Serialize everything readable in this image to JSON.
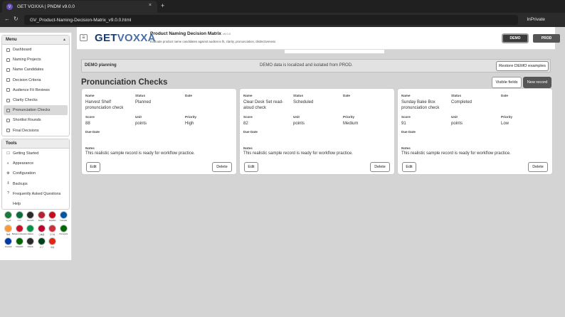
{
  "browser": {
    "tab_title": "GET VOXXA | PNDM v9.0.0",
    "tab_icon_letter": "V",
    "close_glyph": "×",
    "new_tab_glyph": "+",
    "back_glyph": "←",
    "reload_glyph": "↻",
    "url": "GV_Product-Naming-Decision-Matrix_v9.0.0.html",
    "mode": "InPrivate"
  },
  "sidebar": {
    "menu_title": "Menu",
    "caret": "▴",
    "menu_items": [
      {
        "label": "Dashboard",
        "active": false
      },
      {
        "label": "Naming Projects",
        "active": false
      },
      {
        "label": "Name Candidates",
        "active": false
      },
      {
        "label": "Decision Criteria",
        "active": false
      },
      {
        "label": "Audience Fit Reviews",
        "active": false
      },
      {
        "label": "Clarity Checks",
        "active": false
      },
      {
        "label": "Pronunciation Checks",
        "active": true
      },
      {
        "label": "Shortlist Rounds",
        "active": false
      },
      {
        "label": "Final Decisions",
        "active": false
      }
    ],
    "tools_title": "Tools",
    "tools_items": [
      {
        "label": "Getting Started",
        "icon": "☐"
      },
      {
        "label": "Appearance",
        "icon": "◐"
      },
      {
        "label": "Configuration",
        "icon": "⚙"
      },
      {
        "label": "Backups",
        "icon": "↥"
      },
      {
        "label": "Frequently Asked Questions",
        "icon": "?"
      },
      {
        "label": "Help",
        "icon": ""
      }
    ],
    "flags": [
      {
        "label": "العربية",
        "color": "#1b7a3a"
      },
      {
        "label": "বাংলা",
        "color": "#0a6e3c"
      },
      {
        "label": "Deutsch",
        "color": "#2a2a2a"
      },
      {
        "label": "English",
        "color": "#b22234"
      },
      {
        "label": "Español",
        "color": "#c60b1e"
      },
      {
        "label": "",
        "color": "#ffffff"
      },
      {
        "label": "Français",
        "color": "#0055a4"
      },
      {
        "label": "हिन्दी",
        "color": "#ff9933"
      },
      {
        "label": "Bahasa Indonesia",
        "color": "#ce1126"
      },
      {
        "label": "Italiano",
        "color": "#009246"
      },
      {
        "label": "日本語",
        "color": "#bc002d"
      },
      {
        "label": "",
        "color": "#ffffff"
      },
      {
        "label": "한국어",
        "color": "#cd2e3a"
      },
      {
        "label": "Português",
        "color": "#006600"
      },
      {
        "label": "Русский",
        "color": "#0039a6"
      },
      {
        "label": "Kiswahili",
        "color": "#006600"
      },
      {
        "label": "Filipino",
        "color": "#2a2a2a"
      },
      {
        "label": "",
        "color": "#ffffff"
      },
      {
        "label": "",
        "color": "#ffffff"
      },
      {
        "label": "اردو",
        "color": "#01411c"
      },
      {
        "label": "中文",
        "color": "#de2910"
      },
      {
        "label": "",
        "color": "#ffffff"
      },
      {
        "label": "",
        "color": "#ffffff"
      },
      {
        "label": "",
        "color": "#ffffff"
      }
    ]
  },
  "header": {
    "logo_part1": "GET",
    "logo_part2": "VOXXA",
    "title": "Product Naming Decision Matrix",
    "version": "v9.0.0",
    "subtitle": "Evaluate product name candidates against audience fit, clarity, pronunciation, distinctiveness",
    "menu_glyph": "☰",
    "demo_label": "DEMO",
    "prod_label": "PROD"
  },
  "banner": {
    "title": "DEMO planning",
    "message": "DEMO data is localized and isolated from PROD.",
    "restore_label": "Restore DEMO examples"
  },
  "main": {
    "section_title": "Pronunciation Checks",
    "visible_fields_label": "Visible fields",
    "new_record_label": "New record",
    "field_labels": {
      "name": "Name",
      "status": "Status",
      "date": "Date",
      "score": "Score",
      "unit": "Unit",
      "priority": "Priority",
      "due_date": "Due Date",
      "notes": "Notes"
    },
    "edit_label": "Edit",
    "delete_label": "Delete",
    "cards": [
      {
        "name": "Harvest Shelf pronunciation check",
        "status": "Planned",
        "date": "",
        "score": "88",
        "unit": "points",
        "priority": "High",
        "due_date": "",
        "notes": "This realistic sample record is ready for workflow practice."
      },
      {
        "name": "Clear Desk Set read-aloud check",
        "status": "Scheduled",
        "date": "",
        "score": "82",
        "unit": "points",
        "priority": "Medium",
        "due_date": "",
        "notes": "This realistic sample record is ready for workflow practice."
      },
      {
        "name": "Sunday Bake Box pronunciation check",
        "status": "Completed",
        "date": "",
        "score": "91",
        "unit": "points",
        "priority": "Low",
        "due_date": "",
        "notes": "This realistic sample record is ready for workflow practice."
      }
    ]
  }
}
